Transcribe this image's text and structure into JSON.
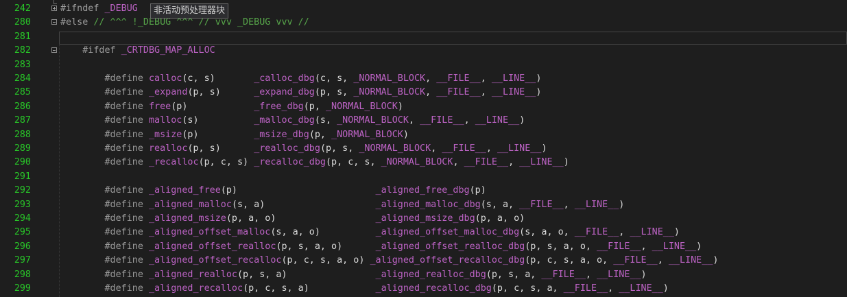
{
  "tooltip": "非活动预处理器块",
  "lines": [
    {
      "num": "242",
      "fold": "plus",
      "segs": [
        [
          "pp",
          "#ifndef "
        ],
        [
          "mac",
          "_DEBUG"
        ]
      ]
    },
    {
      "num": "280",
      "fold": "minus",
      "segs": [
        [
          "pp",
          "#else "
        ],
        [
          "cm",
          "// ^^^ !_DEBUG ^^^ // vvv _DEBUG vvv //"
        ]
      ]
    },
    {
      "num": "281",
      "fold": "",
      "segs": []
    },
    {
      "num": "282",
      "fold": "minus",
      "segs": [
        [
          "def",
          "    "
        ],
        [
          "pp",
          "#ifdef "
        ],
        [
          "mac",
          "_CRTDBG_MAP_ALLOC"
        ]
      ]
    },
    {
      "num": "283",
      "fold": "",
      "segs": []
    },
    {
      "num": "284",
      "fold": "",
      "segs": [
        [
          "def",
          "        "
        ],
        [
          "pp",
          "#define "
        ],
        [
          "mac",
          "calloc"
        ],
        [
          "def",
          "(c, s)       "
        ],
        [
          "mac",
          "_calloc_dbg"
        ],
        [
          "def",
          "(c, s, "
        ],
        [
          "mac",
          "_NORMAL_BLOCK"
        ],
        [
          "def",
          ", "
        ],
        [
          "mac",
          "__FILE__"
        ],
        [
          "def",
          ", "
        ],
        [
          "mac",
          "__LINE__"
        ],
        [
          "def",
          ")"
        ]
      ]
    },
    {
      "num": "285",
      "fold": "",
      "segs": [
        [
          "def",
          "        "
        ],
        [
          "pp",
          "#define "
        ],
        [
          "mac",
          "_expand"
        ],
        [
          "def",
          "(p, s)      "
        ],
        [
          "mac",
          "_expand_dbg"
        ],
        [
          "def",
          "(p, s, "
        ],
        [
          "mac",
          "_NORMAL_BLOCK"
        ],
        [
          "def",
          ", "
        ],
        [
          "mac",
          "__FILE__"
        ],
        [
          "def",
          ", "
        ],
        [
          "mac",
          "__LINE__"
        ],
        [
          "def",
          ")"
        ]
      ]
    },
    {
      "num": "286",
      "fold": "",
      "segs": [
        [
          "def",
          "        "
        ],
        [
          "pp",
          "#define "
        ],
        [
          "mac",
          "free"
        ],
        [
          "def",
          "(p)            "
        ],
        [
          "mac",
          "_free_dbg"
        ],
        [
          "def",
          "(p, "
        ],
        [
          "mac",
          "_NORMAL_BLOCK"
        ],
        [
          "def",
          ")"
        ]
      ]
    },
    {
      "num": "287",
      "fold": "",
      "segs": [
        [
          "def",
          "        "
        ],
        [
          "pp",
          "#define "
        ],
        [
          "mac",
          "malloc"
        ],
        [
          "def",
          "(s)          "
        ],
        [
          "mac",
          "_malloc_dbg"
        ],
        [
          "def",
          "(s, "
        ],
        [
          "mac",
          "_NORMAL_BLOCK"
        ],
        [
          "def",
          ", "
        ],
        [
          "mac",
          "__FILE__"
        ],
        [
          "def",
          ", "
        ],
        [
          "mac",
          "__LINE__"
        ],
        [
          "def",
          ")"
        ]
      ]
    },
    {
      "num": "288",
      "fold": "",
      "segs": [
        [
          "def",
          "        "
        ],
        [
          "pp",
          "#define "
        ],
        [
          "mac",
          "_msize"
        ],
        [
          "def",
          "(p)          "
        ],
        [
          "mac",
          "_msize_dbg"
        ],
        [
          "def",
          "(p, "
        ],
        [
          "mac",
          "_NORMAL_BLOCK"
        ],
        [
          "def",
          ")"
        ]
      ]
    },
    {
      "num": "289",
      "fold": "",
      "segs": [
        [
          "def",
          "        "
        ],
        [
          "pp",
          "#define "
        ],
        [
          "mac",
          "realloc"
        ],
        [
          "def",
          "(p, s)      "
        ],
        [
          "mac",
          "_realloc_dbg"
        ],
        [
          "def",
          "(p, s, "
        ],
        [
          "mac",
          "_NORMAL_BLOCK"
        ],
        [
          "def",
          ", "
        ],
        [
          "mac",
          "__FILE__"
        ],
        [
          "def",
          ", "
        ],
        [
          "mac",
          "__LINE__"
        ],
        [
          "def",
          ")"
        ]
      ]
    },
    {
      "num": "290",
      "fold": "",
      "segs": [
        [
          "def",
          "        "
        ],
        [
          "pp",
          "#define "
        ],
        [
          "mac",
          "_recalloc"
        ],
        [
          "def",
          "(p, c, s) "
        ],
        [
          "mac",
          "_recalloc_dbg"
        ],
        [
          "def",
          "(p, c, s, "
        ],
        [
          "mac",
          "_NORMAL_BLOCK"
        ],
        [
          "def",
          ", "
        ],
        [
          "mac",
          "__FILE__"
        ],
        [
          "def",
          ", "
        ],
        [
          "mac",
          "__LINE__"
        ],
        [
          "def",
          ")"
        ]
      ]
    },
    {
      "num": "291",
      "fold": "",
      "segs": []
    },
    {
      "num": "292",
      "fold": "",
      "segs": [
        [
          "def",
          "        "
        ],
        [
          "pp",
          "#define "
        ],
        [
          "mac",
          "_aligned_free"
        ],
        [
          "def",
          "(p)                         "
        ],
        [
          "mac",
          "_aligned_free_dbg"
        ],
        [
          "def",
          "(p)"
        ]
      ]
    },
    {
      "num": "293",
      "fold": "",
      "segs": [
        [
          "def",
          "        "
        ],
        [
          "pp",
          "#define "
        ],
        [
          "mac",
          "_aligned_malloc"
        ],
        [
          "def",
          "(s, a)                    "
        ],
        [
          "mac",
          "_aligned_malloc_dbg"
        ],
        [
          "def",
          "(s, a, "
        ],
        [
          "mac",
          "__FILE__"
        ],
        [
          "def",
          ", "
        ],
        [
          "mac",
          "__LINE__"
        ],
        [
          "def",
          ")"
        ]
      ]
    },
    {
      "num": "294",
      "fold": "",
      "segs": [
        [
          "def",
          "        "
        ],
        [
          "pp",
          "#define "
        ],
        [
          "mac",
          "_aligned_msize"
        ],
        [
          "def",
          "(p, a, o)                  "
        ],
        [
          "mac",
          "_aligned_msize_dbg"
        ],
        [
          "def",
          "(p, a, o)"
        ]
      ]
    },
    {
      "num": "295",
      "fold": "",
      "segs": [
        [
          "def",
          "        "
        ],
        [
          "pp",
          "#define "
        ],
        [
          "mac",
          "_aligned_offset_malloc"
        ],
        [
          "def",
          "(s, a, o)          "
        ],
        [
          "mac",
          "_aligned_offset_malloc_dbg"
        ],
        [
          "def",
          "(s, a, o, "
        ],
        [
          "mac",
          "__FILE__"
        ],
        [
          "def",
          ", "
        ],
        [
          "mac",
          "__LINE__"
        ],
        [
          "def",
          ")"
        ]
      ]
    },
    {
      "num": "296",
      "fold": "",
      "segs": [
        [
          "def",
          "        "
        ],
        [
          "pp",
          "#define "
        ],
        [
          "mac",
          "_aligned_offset_realloc"
        ],
        [
          "def",
          "(p, s, a, o)      "
        ],
        [
          "mac",
          "_aligned_offset_realloc_dbg"
        ],
        [
          "def",
          "(p, s, a, o, "
        ],
        [
          "mac",
          "__FILE__"
        ],
        [
          "def",
          ", "
        ],
        [
          "mac",
          "__LINE__"
        ],
        [
          "def",
          ")"
        ]
      ]
    },
    {
      "num": "297",
      "fold": "",
      "segs": [
        [
          "def",
          "        "
        ],
        [
          "pp",
          "#define "
        ],
        [
          "mac",
          "_aligned_offset_recalloc"
        ],
        [
          "def",
          "(p, c, s, a, o) "
        ],
        [
          "mac",
          "_aligned_offset_recalloc_dbg"
        ],
        [
          "def",
          "(p, c, s, a, o, "
        ],
        [
          "mac",
          "__FILE__"
        ],
        [
          "def",
          ", "
        ],
        [
          "mac",
          "__LINE__"
        ],
        [
          "def",
          ")"
        ]
      ]
    },
    {
      "num": "298",
      "fold": "",
      "segs": [
        [
          "def",
          "        "
        ],
        [
          "pp",
          "#define "
        ],
        [
          "mac",
          "_aligned_realloc"
        ],
        [
          "def",
          "(p, s, a)                "
        ],
        [
          "mac",
          "_aligned_realloc_dbg"
        ],
        [
          "def",
          "(p, s, a, "
        ],
        [
          "mac",
          "__FILE__"
        ],
        [
          "def",
          ", "
        ],
        [
          "mac",
          "__LINE__"
        ],
        [
          "def",
          ")"
        ]
      ]
    },
    {
      "num": "299",
      "fold": "",
      "segs": [
        [
          "def",
          "        "
        ],
        [
          "pp",
          "#define "
        ],
        [
          "mac",
          "_aligned_recalloc"
        ],
        [
          "def",
          "(p, c, s, a)            "
        ],
        [
          "mac",
          "_aligned_recalloc_dbg"
        ],
        [
          "def",
          "(p, c, s, a, "
        ],
        [
          "mac",
          "__FILE__"
        ],
        [
          "def",
          ", "
        ],
        [
          "mac",
          "__LINE__"
        ],
        [
          "def",
          ")"
        ]
      ]
    }
  ]
}
